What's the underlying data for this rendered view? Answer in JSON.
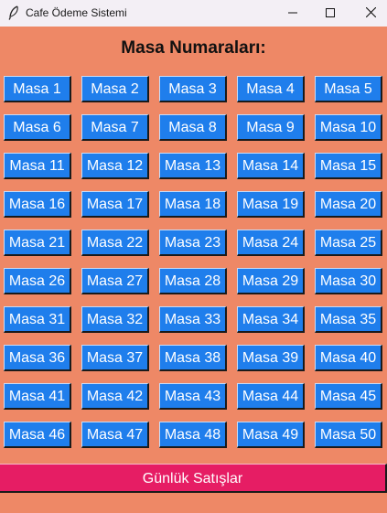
{
  "window": {
    "title": "Cafe Ödeme Sistemi"
  },
  "heading": "Masa Numaraları:",
  "tables": [
    "Masa 1",
    "Masa 2",
    "Masa 3",
    "Masa 4",
    "Masa 5",
    "Masa 6",
    "Masa 7",
    "Masa 8",
    "Masa 9",
    "Masa 10",
    "Masa 11",
    "Masa 12",
    "Masa 13",
    "Masa 14",
    "Masa 15",
    "Masa 16",
    "Masa 17",
    "Masa 18",
    "Masa 19",
    "Masa 20",
    "Masa 21",
    "Masa 22",
    "Masa 23",
    "Masa 24",
    "Masa 25",
    "Masa 26",
    "Masa 27",
    "Masa 28",
    "Masa 29",
    "Masa 30",
    "Masa 31",
    "Masa 32",
    "Masa 33",
    "Masa 34",
    "Masa 35",
    "Masa 36",
    "Masa 37",
    "Masa 38",
    "Masa 39",
    "Masa 40",
    "Masa 41",
    "Masa 42",
    "Masa 43",
    "Masa 44",
    "Masa 45",
    "Masa 46",
    "Masa 47",
    "Masa 48",
    "Masa 49",
    "Masa 50"
  ],
  "sales_button": "Günlük Satışlar",
  "colors": {
    "background": "#ee8866",
    "table_button": "#1f7eec",
    "sales_button": "#e61d64"
  },
  "icons": {
    "app": "feather-icon",
    "minimize": "minimize-icon",
    "maximize": "maximize-icon",
    "close": "close-icon"
  }
}
